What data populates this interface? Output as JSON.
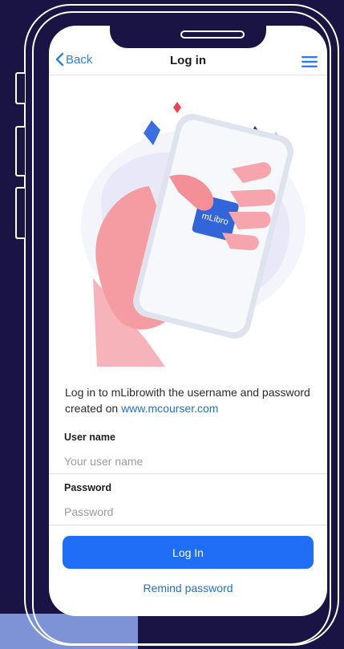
{
  "nav": {
    "back_label": "Back",
    "title": "Log in",
    "back_icon": "chevron-left-icon",
    "menu_icon": "hamburger-menu-icon"
  },
  "illustration": {
    "logo_text": "mLibro"
  },
  "intro": {
    "text": "Log in to mLibrowith the username and password created on ",
    "link": "www.mcourser.com"
  },
  "form": {
    "username_label": "User name",
    "username_placeholder": "Your user name",
    "username_value": "",
    "password_label": "Password",
    "password_placeholder": "Password",
    "password_value": ""
  },
  "actions": {
    "login_label": "Log In",
    "remind_label": "Remind password"
  },
  "colors": {
    "background": "#1a1444",
    "accent": "#1f6ef5",
    "link": "#1f6fe8",
    "accent_block": "#7d93d6"
  }
}
